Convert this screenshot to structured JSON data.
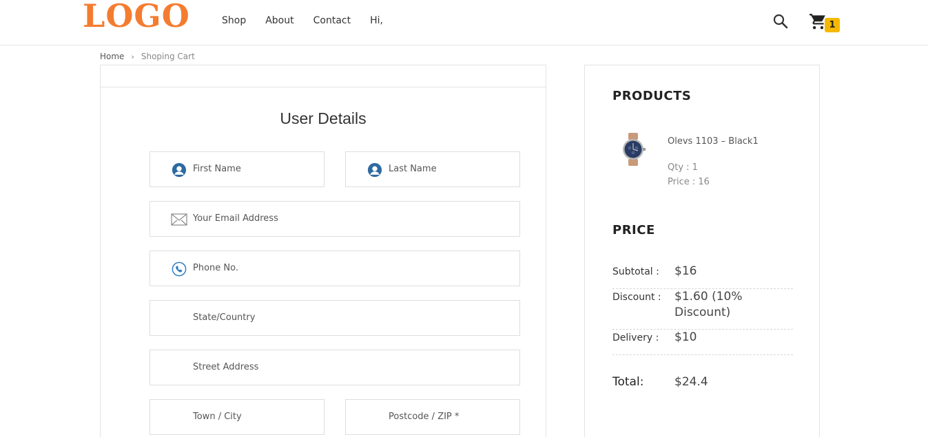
{
  "header": {
    "logo": "LOGO",
    "nav": [
      "Shop",
      "About",
      "Contact",
      "Hi,"
    ],
    "cart_count": "1",
    "colors": {
      "logo": "#f47c30",
      "badge": "#f5b800"
    }
  },
  "breadcrumb": {
    "home": "Home",
    "current": "Shoping Cart"
  },
  "form": {
    "title": "User Details",
    "first_name": "First Name",
    "last_name": "Last Name",
    "email": "Your Email Address",
    "phone": "Phone No.",
    "state": "State/Country",
    "street": "Street Address",
    "town": "Town / City",
    "postcode": "Postcode / ZIP *"
  },
  "summary": {
    "products_heading": "PRODUCTS",
    "product": {
      "name": "Olevs 1103 – Black1",
      "qty": "Qty : 1",
      "price": "Price : 16"
    },
    "price_heading": "PRICE",
    "subtotal_label": "Subtotal :",
    "subtotal_value": "$16",
    "discount_label": "Discount :",
    "discount_value": "$1.60 (10% Discount)",
    "delivery_label": "Delivery :",
    "delivery_value": "$10",
    "total_label": "Total:",
    "total_value": "$24.4"
  },
  "icons": [
    "search-icon",
    "cart-icon",
    "user-icon",
    "mail-icon",
    "phone-icon",
    "chevron-right-icon"
  ]
}
